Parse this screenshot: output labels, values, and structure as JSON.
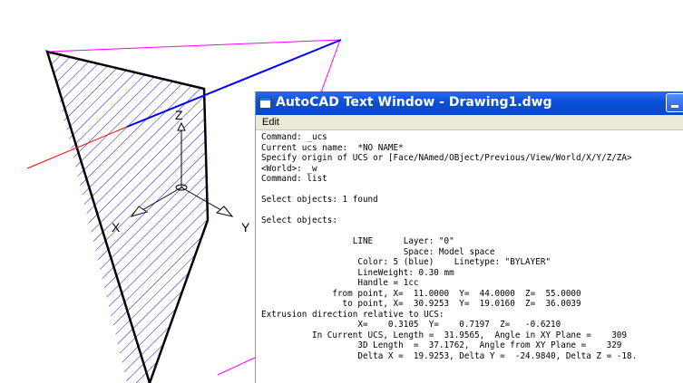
{
  "window": {
    "title": "AutoCAD Text Window - Drawing1.dwg",
    "menu_edit": "Edit"
  },
  "console_lines": [
    "Command: _ucs",
    "Current ucs name:  *NO NAME*",
    "Specify origin of UCS or [Face/NAmed/OBject/Previous/View/World/X/Y/Z/ZA>",
    "<World>: _w",
    "Command: list",
    "",
    "Select objects: 1 found",
    "",
    "Select objects:",
    "",
    "                  LINE      Layer: \"0\"",
    "                            Space: Model space",
    "                   Color: 5 (blue)    Linetype: \"BYLAYER\"",
    "                   LineWeight: 0.30 mm",
    "                   Handle = 1cc",
    "              from point, X=  11.0000  Y=  44.0000  Z=  55.0000",
    "                to point, X=  30.9253  Y=  19.0160  Z=  36.0039",
    "Extrusion direction relative to UCS:",
    "                   X=    0.3105  Y=    0.7197  Z=   -0.6210",
    "          In Current UCS, Length =  31.9565,  Angle in XY Plane =    309",
    "                   3D Length  =  37.1762,  Angle from XY Plane =    329",
    "                   Delta X =  19.9253, Delta Y =  -24.9840, Delta Z = -18."
  ],
  "viewport_labels": {
    "ucs_x": "X",
    "ucs_y": "Y",
    "ucs_z": "Z"
  },
  "colors": {
    "hatch": "#1515e8",
    "blue_line": "#0000ff",
    "red_axis": "#ff0000",
    "magenta_line": "#ff00ff",
    "titlebar": "#0a4fd8"
  }
}
